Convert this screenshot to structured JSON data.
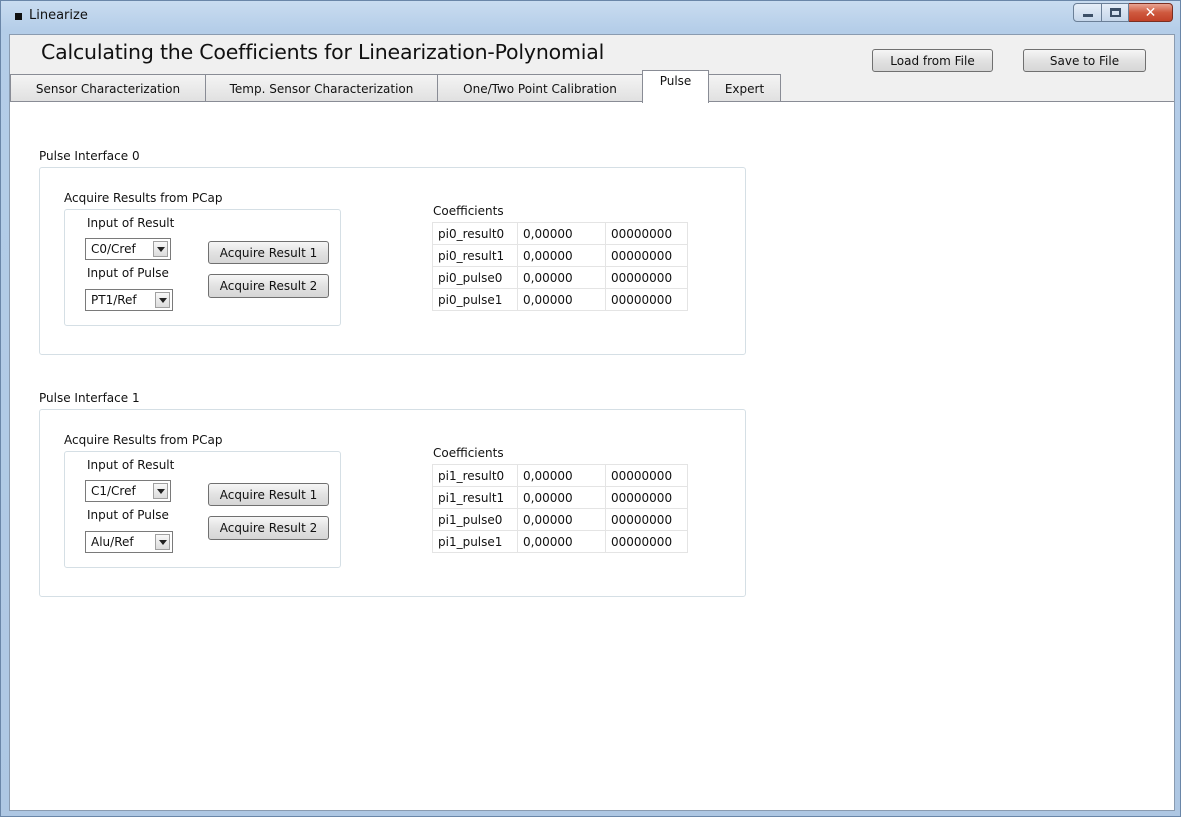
{
  "window": {
    "title": "Linearize"
  },
  "header": {
    "title": "Calculating the Coefficients for Linearization-Polynomial",
    "load_label": "Load from File",
    "save_label": "Save to File"
  },
  "tabs": [
    {
      "label": "Sensor Characterization"
    },
    {
      "label": "Temp. Sensor Characterization"
    },
    {
      "label": "One/Two Point Calibration"
    },
    {
      "label": "Pulse",
      "active": true
    },
    {
      "label": "Expert"
    }
  ],
  "interfaces": [
    {
      "title": "Pulse Interface 0",
      "acquire_title": "Acquire Results from PCap",
      "input_result_label": "Input of Result",
      "input_result_value": "C0/Cref",
      "input_pulse_label": "Input of Pulse",
      "input_pulse_value": "PT1/Ref",
      "acquire1_label": "Acquire Result 1",
      "acquire2_label": "Acquire Result 2",
      "coefficients_title": "Coefficients",
      "rows": [
        [
          "pi0_result0",
          "0,00000",
          "00000000"
        ],
        [
          "pi0_result1",
          "0,00000",
          "00000000"
        ],
        [
          "pi0_pulse0",
          "0,00000",
          "00000000"
        ],
        [
          "pi0_pulse1",
          "0,00000",
          "00000000"
        ]
      ]
    },
    {
      "title": "Pulse Interface 1",
      "acquire_title": "Acquire Results from PCap",
      "input_result_label": "Input of Result",
      "input_result_value": "C1/Cref",
      "input_pulse_label": "Input of Pulse",
      "input_pulse_value": "Alu/Ref",
      "acquire1_label": "Acquire Result 1",
      "acquire2_label": "Acquire Result 2",
      "coefficients_title": "Coefficients",
      "rows": [
        [
          "pi1_result0",
          "0,00000",
          "00000000"
        ],
        [
          "pi1_result1",
          "0,00000",
          "00000000"
        ],
        [
          "pi1_pulse0",
          "0,00000",
          "00000000"
        ],
        [
          "pi1_pulse1",
          "0,00000",
          "00000000"
        ]
      ]
    }
  ],
  "colors": {
    "frame": "#aec7e3",
    "close_button": "#c24128",
    "client_bg": "#f0f0f0",
    "tab_page_bg": "#ffffff"
  }
}
